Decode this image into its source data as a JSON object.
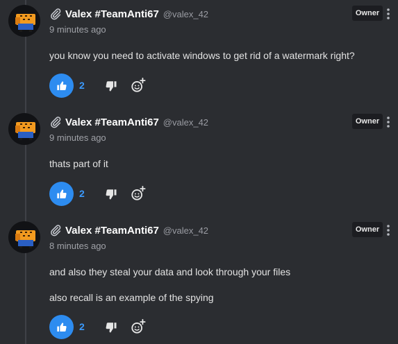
{
  "comments": [
    {
      "author": "Valex #TeamAnti67",
      "handle": "@valex_42",
      "time": "9 minutes ago",
      "badge": "Owner",
      "lines": [
        "you know you need to activate windows to get rid of a watermark right?"
      ],
      "likes": "2"
    },
    {
      "author": "Valex #TeamAnti67",
      "handle": "@valex_42",
      "time": "9 minutes ago",
      "badge": "Owner",
      "lines": [
        "thats part of it"
      ],
      "likes": "2"
    },
    {
      "author": "Valex #TeamAnti67",
      "handle": "@valex_42",
      "time": "8 minutes ago",
      "badge": "Owner",
      "lines": [
        "and also they steal your data and look through your files",
        "also recall is an example of the spying"
      ],
      "likes": "2"
    }
  ],
  "icons": {
    "author_prefix": "paperclip-icon",
    "like": "thumbs-up-icon",
    "dislike": "thumbs-down-icon",
    "react": "add-reaction-icon",
    "menu": "vertical-dots-icon"
  },
  "colors": {
    "background": "#2b2d31",
    "accent": "#2d8cf0",
    "badge_bg": "#1c1d21"
  }
}
